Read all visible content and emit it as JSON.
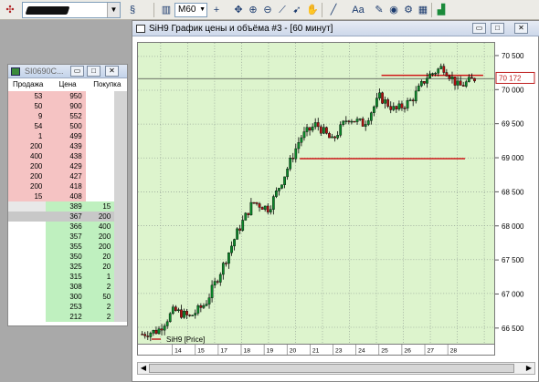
{
  "toolbar": {
    "interval": "M60",
    "text_tool_label": "Aa"
  },
  "order_book": {
    "title": "SI0690C...",
    "columns": [
      "Продажа",
      "Цена",
      "Покупка"
    ],
    "sell_rows": [
      [
        "53",
        "950",
        ""
      ],
      [
        "50",
        "900",
        ""
      ],
      [
        "9",
        "552",
        ""
      ],
      [
        "54",
        "500",
        ""
      ],
      [
        "1",
        "499",
        ""
      ],
      [
        "200",
        "439",
        ""
      ],
      [
        "400",
        "438",
        ""
      ],
      [
        "200",
        "429",
        ""
      ],
      [
        "200",
        "427",
        ""
      ],
      [
        "200",
        "418",
        ""
      ],
      [
        "15",
        "408",
        ""
      ]
    ],
    "buy_rows": [
      [
        "",
        "389",
        "15"
      ],
      [
        "",
        "367",
        "200"
      ],
      [
        "",
        "366",
        "400"
      ],
      [
        "",
        "357",
        "200"
      ],
      [
        "",
        "355",
        "200"
      ],
      [
        "",
        "350",
        "20"
      ],
      [
        "",
        "325",
        "20"
      ],
      [
        "",
        "315",
        "1"
      ],
      [
        "",
        "308",
        "2"
      ],
      [
        "",
        "300",
        "50"
      ],
      [
        "",
        "253",
        "2"
      ],
      [
        "",
        "212",
        "2"
      ]
    ]
  },
  "chart_window": {
    "title": "SiH9 График цены и объёма #3 - [60 минут]",
    "legend_label": "SiH9 [Price]",
    "current_price": "70 172"
  },
  "chart_data": {
    "type": "line",
    "x": [
      "14",
      "15",
      "17",
      "18",
      "19",
      "20",
      "21",
      "23",
      "24",
      "25",
      "26",
      "27",
      "28"
    ],
    "yticks": [
      66500,
      67000,
      67500,
      68000,
      68500,
      69000,
      69500,
      70000,
      70500
    ],
    "ylim": [
      66150,
      70700
    ],
    "series": [
      {
        "values": [
          66400,
          66450,
          66750,
          66650,
          66850,
          67350,
          67900,
          68350,
          68250,
          68750,
          69300,
          69500,
          69250,
          69600,
          69500,
          69900,
          69700,
          69850,
          70200,
          70350,
          70050,
          70172
        ]
      }
    ],
    "horizontal_levels": [
      70220,
      68990
    ],
    "current_price": 70172
  }
}
